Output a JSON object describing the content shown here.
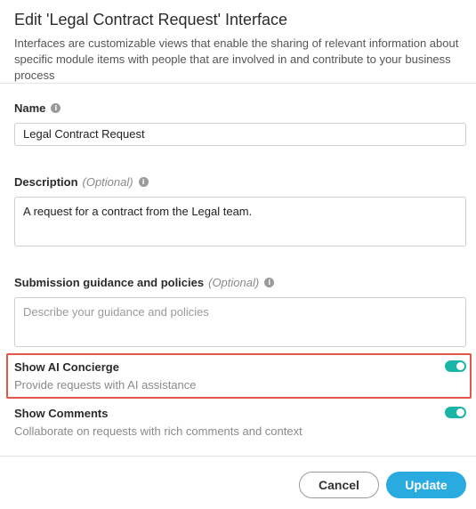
{
  "dialog": {
    "title": "Edit 'Legal Contract Request' Interface",
    "subtitle": "Interfaces are customizable views that enable the sharing of relevant information about specific module items with people that are involved in and contribute to your business process"
  },
  "fields": {
    "name": {
      "label": "Name",
      "value": "Legal Contract Request",
      "info_icon": "info-icon"
    },
    "description": {
      "label": "Description",
      "optional": "(Optional)",
      "value": "A request for a contract from the Legal team.",
      "info_icon": "info-icon"
    },
    "guidance": {
      "label": "Submission guidance and policies",
      "optional": "(Optional)",
      "placeholder": "Describe your guidance and policies",
      "info_icon": "info-icon"
    }
  },
  "toggles": {
    "ai_concierge": {
      "title": "Show AI Concierge",
      "description": "Provide requests with AI assistance",
      "enabled": true
    },
    "comments": {
      "title": "Show Comments",
      "description": "Collaborate on requests with rich comments and context",
      "enabled": true
    }
  },
  "footer": {
    "cancel_label": "Cancel",
    "update_label": "Update"
  },
  "colors": {
    "accent": "#2aabe0",
    "toggle_on": "#19b5a6",
    "highlight_border": "#e3574a"
  }
}
